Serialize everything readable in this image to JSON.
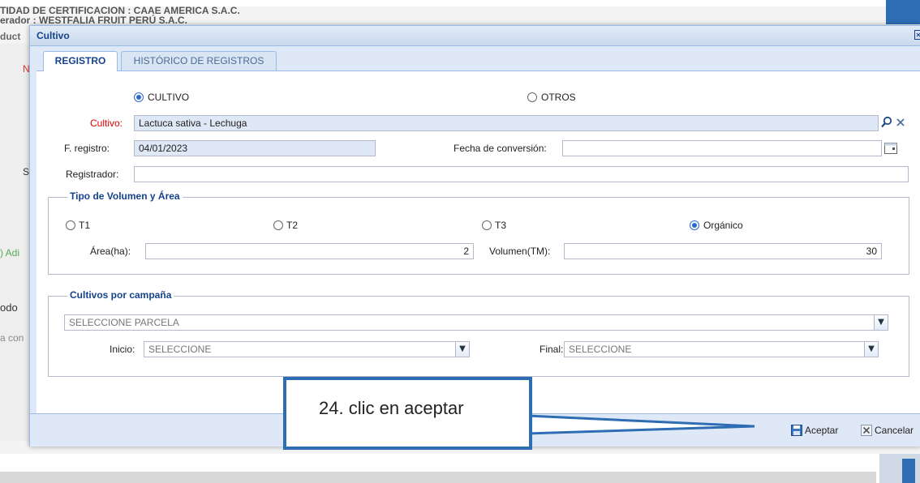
{
  "background": {
    "header_line1": "TIDAD DE CERTIFICACION : CAAE AMERICA S.A.C.",
    "header_line2": "erador : WESTFALIA FRUIT PERÚ S.A.C.",
    "header_line3": "duct",
    "left_label_n": "N",
    "left_label_s": "S",
    "left_add": ") Adi",
    "left_modo": "odo",
    "left_acom": "a con"
  },
  "dialog": {
    "title": "Cultivo",
    "close_icon": "close-icon",
    "tabs": [
      {
        "label": "REGISTRO",
        "active": true
      },
      {
        "label": "HISTÓRICO DE REGISTROS",
        "active": false
      }
    ],
    "type_radios": [
      {
        "label": "CULTIVO",
        "selected": true
      },
      {
        "label": "OTROS",
        "selected": false
      }
    ],
    "cultivo": {
      "label": "Cultivo:",
      "value": "Lactuca sativa   - Lechuga"
    },
    "f_registro": {
      "label": "F. registro:",
      "value": "04/01/2023"
    },
    "fecha_conversion": {
      "label": "Fecha de conversión:",
      "value": ""
    },
    "registrador": {
      "label": "Registrador:",
      "value": ""
    },
    "volumen_area": {
      "legend": "Tipo de Volumen y Área",
      "radios": [
        {
          "label": "T1",
          "selected": false
        },
        {
          "label": "T2",
          "selected": false
        },
        {
          "label": "T3",
          "selected": false
        },
        {
          "label": "Orgánico",
          "selected": true
        }
      ],
      "area_label": "Área(ha):",
      "area_value": "2",
      "volumen_label": "Volumen(TM):",
      "volumen_value": "30"
    },
    "cultivos_campana": {
      "legend": "Cultivos por campaña",
      "parcela_placeholder": "SELECCIONE PARCELA",
      "inicio_label": "Inicio:",
      "inicio_value": "SELECCIONE",
      "final_label": "Final:",
      "final_value": "SELECCIONE"
    },
    "footer": {
      "accept_label": "Aceptar",
      "cancel_label": "Cancelar"
    }
  },
  "annotation": {
    "text": "24. clic en aceptar"
  },
  "colors": {
    "accent": "#15428b",
    "panel": "#dfe8f6",
    "callout_border": "#2e6db4",
    "required_label": "#d00000"
  }
}
